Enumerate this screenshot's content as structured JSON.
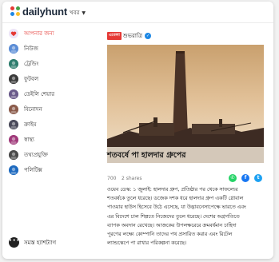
{
  "header": {
    "logo_text": "dailyhunt",
    "language_label": "খবর",
    "logo_colors": [
      "#e53935",
      "#43a047",
      "#1e88e5",
      "#fbc02d"
    ]
  },
  "sidebar": {
    "items": [
      {
        "label": "আপনার জন্য",
        "icon": "for-you-icon",
        "active": true,
        "color": "#e8e0f5"
      },
      {
        "label": "নিউজ",
        "icon": "news-icon",
        "active": false,
        "color": "#5c8dd6"
      },
      {
        "label": "ট্রেন্ডিং",
        "icon": "trending-icon",
        "active": false,
        "color": "#2e7d6e"
      },
      {
        "label": "ফুটবল",
        "icon": "football-icon",
        "active": false,
        "color": "#3a3a3a"
      },
      {
        "label": "ডেইলি শেয়ার",
        "icon": "daily-share-icon",
        "active": false,
        "color": "#6a5a8a"
      },
      {
        "label": "বিনোদন",
        "icon": "entertainment-icon",
        "active": false,
        "color": "#8a5a4a"
      },
      {
        "label": "ক্রাইম",
        "icon": "crime-icon",
        "active": false,
        "color": "#4a4a5a"
      },
      {
        "label": "স্বাস্থ্য",
        "icon": "health-icon",
        "active": false,
        "color": "#a03a7a"
      },
      {
        "label": "তথ্যপ্রযুক্তি",
        "icon": "technology-icon",
        "active": false,
        "color": "#4a4a4a"
      },
      {
        "label": "পলিটিক্স",
        "icon": "politics-icon",
        "active": false,
        "color": "#1e6abf"
      }
    ],
    "all_hashtags_label": "সমস্ত হ্যাশট্যাগ",
    "all_hashtags_icon": "more-dots-icon"
  },
  "article": {
    "source_badge": "এবেলা",
    "source_name": "শুভরাত্রি",
    "verified_icon": "verified-check-icon",
    "headline": "শতবর্ষে পা হালদার গ্রুপের",
    "views": "700",
    "shares": "2 shares",
    "share_icons": [
      {
        "name": "whatsapp-icon",
        "glyph": "✆",
        "color": "#25d366"
      },
      {
        "name": "facebook-icon",
        "glyph": "f",
        "color": "#1877f2"
      },
      {
        "name": "twitter-icon",
        "glyph": "t",
        "color": "#1da1f2"
      }
    ],
    "body_lines": [
      "ওয়েব ডেস্ক: ১ জুলাই: হালদার গ্রুপ, প্রতিষ্ঠার পর থেকে সাফল্যের",
      "শতবর্ষকে তুলে ধরেছে। ডজেক দশক ধরে হালদার গ্রুপ একটি গ্লোবাল",
      "পাওয়ার হাউস হিসেবে উঠে এসেছে, যা উদ্ভাবনেসাপেক্ষে ভারতে এবং",
      "এর বিদেশে চাল শিল্পতে নিজেদের তুলে ধরেছে। দেশের অগ্রগতিতে",
      "ব্যাপক অবদান রেখেছে। আজকের উপলক্ষরেরে ক্রমবর্ধমান চাহিদা",
      "পূরণের লক্ষ্যে কোম্পানি তাদের পথ প্রসারিত করার এবং রিটেল",
      "ল্যান্ডস্কেপে পা রাখার পরিকল্পনা করেছে।"
    ]
  }
}
